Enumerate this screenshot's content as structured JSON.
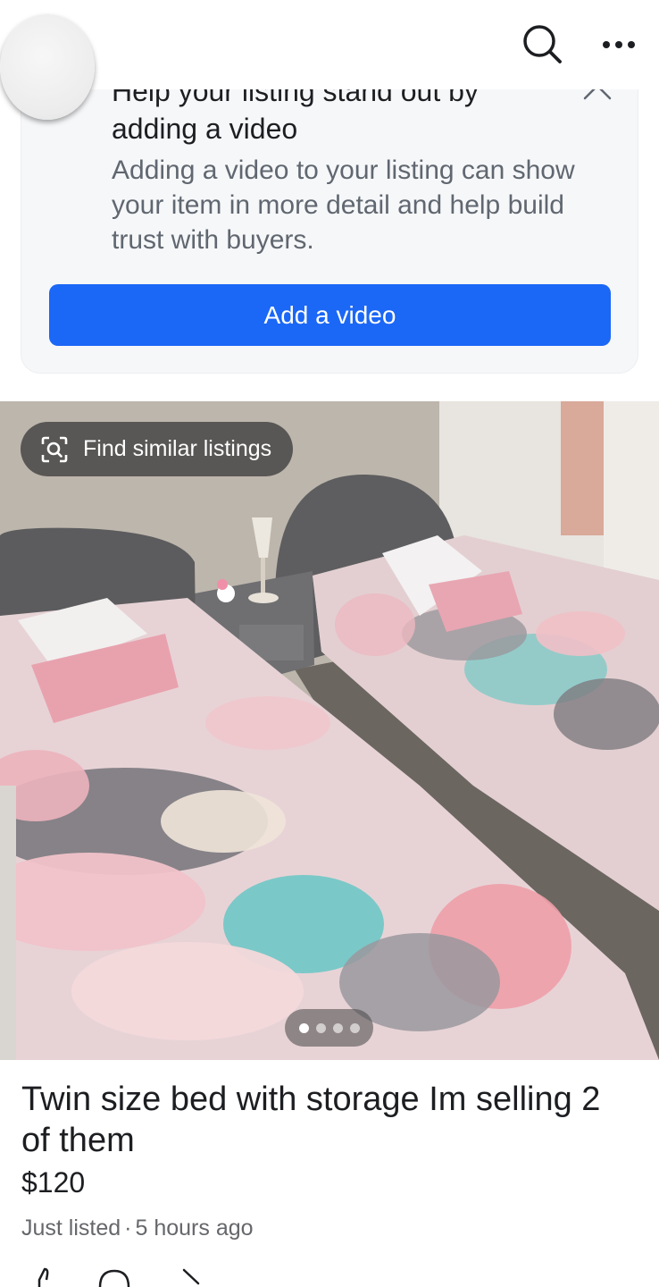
{
  "header": {
    "search_icon": "search-icon",
    "more_icon": "more-horizontal-icon"
  },
  "promo": {
    "title_line1": "Help your listing stand out by",
    "title_line2": "adding a video",
    "body": "Adding a video to your listing can show your item in more detail and help build trust with buyers.",
    "button_label": "Add a video",
    "button_color": "#1b67f6"
  },
  "photo": {
    "find_similar_label": "Find similar listings",
    "image_count": 4,
    "active_index": 0
  },
  "listing": {
    "title": "Twin size bed  with storage  Im selling 2 of them",
    "price": "$120",
    "status": "Just listed",
    "separator": "·",
    "time": "5 hours ago"
  },
  "actions": {
    "icons": [
      "like-icon",
      "comment-icon",
      "share-icon"
    ]
  }
}
